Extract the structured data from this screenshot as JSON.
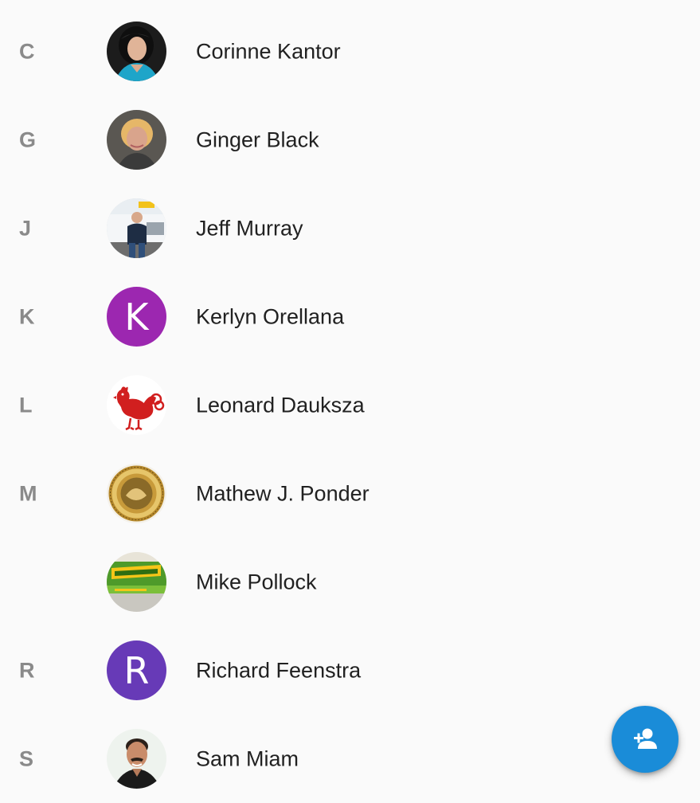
{
  "accent_color": "#1a8cd8",
  "contacts": [
    {
      "letter": "C",
      "name": "Corinne Kantor",
      "avatar": "photo-woman-dark-hair"
    },
    {
      "letter": "G",
      "name": "Ginger Black",
      "avatar": "photo-woman-blonde"
    },
    {
      "letter": "J",
      "name": "Jeff Murray",
      "avatar": "photo-man-with-truck"
    },
    {
      "letter": "K",
      "name": "Kerlyn Orellana",
      "avatar": "initial",
      "initial": "K",
      "avatar_color": "#9c27b0"
    },
    {
      "letter": "L",
      "name": "Leonard Dauksza",
      "avatar": "logo-red-rooster"
    },
    {
      "letter": "M",
      "name": "Mathew J. Ponder",
      "avatar": "logo-gold-seal"
    },
    {
      "letter": "",
      "name": "Mike Pollock",
      "avatar": "logo-quikdry"
    },
    {
      "letter": "R",
      "name": "Richard Feenstra",
      "avatar": "initial",
      "initial": "R",
      "avatar_color": "#673ab7"
    },
    {
      "letter": "S",
      "name": "Sam Miam",
      "avatar": "photo-man-smiling"
    }
  ],
  "fab": {
    "icon": "add-person-icon",
    "color": "#1a8cd8"
  }
}
